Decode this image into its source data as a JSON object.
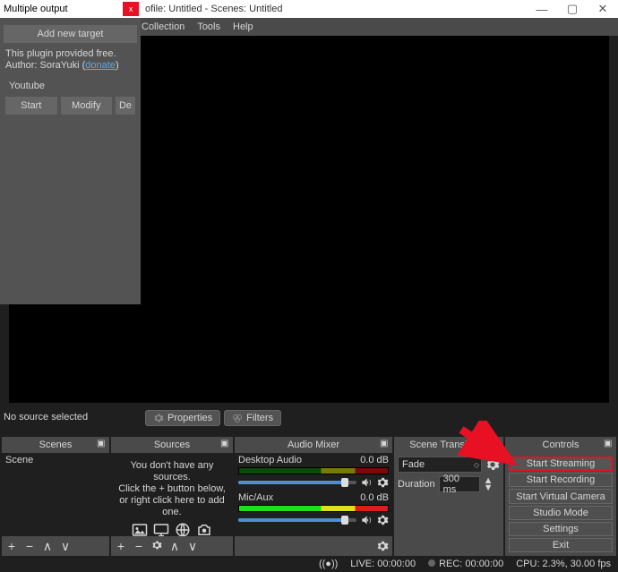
{
  "window": {
    "title_suffix": "ofile: Untitled - Scenes: Untitled"
  },
  "menu": {
    "collection": "Collection",
    "tools": "Tools",
    "help": "Help"
  },
  "popup": {
    "title": "Multiple output",
    "add_target": "Add new target",
    "info_line1": "This plugin provided free.",
    "info_author_prefix": "Author: SoraYuki (",
    "info_donate": "donate",
    "info_author_suffix": ")",
    "section": "Youtube",
    "start": "Start",
    "modify": "Modify",
    "del": "De"
  },
  "no_source": "No source selected",
  "toolbuttons": {
    "properties": "Properties",
    "filters": "Filters"
  },
  "panels": {
    "scenes": "Scenes",
    "sources": "Sources",
    "mixer": "Audio Mixer",
    "transitions": "Scene Transitions",
    "controls": "Controls"
  },
  "scene_list": {
    "item0": "Scene"
  },
  "sources_msg": {
    "l1": "You don't have any sources.",
    "l2": "Click the + button below,",
    "l3": "or right click here to add one."
  },
  "mixer": {
    "desktop": {
      "name": "Desktop Audio",
      "level": "0.0 dB"
    },
    "mic": {
      "name": "Mic/Aux",
      "level": "0.0 dB"
    }
  },
  "transitions": {
    "fade": "Fade",
    "duration_label": "Duration",
    "duration_value": "300 ms"
  },
  "controls": {
    "start_streaming": "Start Streaming",
    "start_recording": "Start Recording",
    "start_vcam": "Start Virtual Camera",
    "studio_mode": "Studio Mode",
    "settings": "Settings",
    "exit": "Exit"
  },
  "status": {
    "live": "LIVE: 00:00:00",
    "rec": "REC: 00:00:00",
    "cpu": "CPU: 2.3%, 30.00 fps"
  }
}
